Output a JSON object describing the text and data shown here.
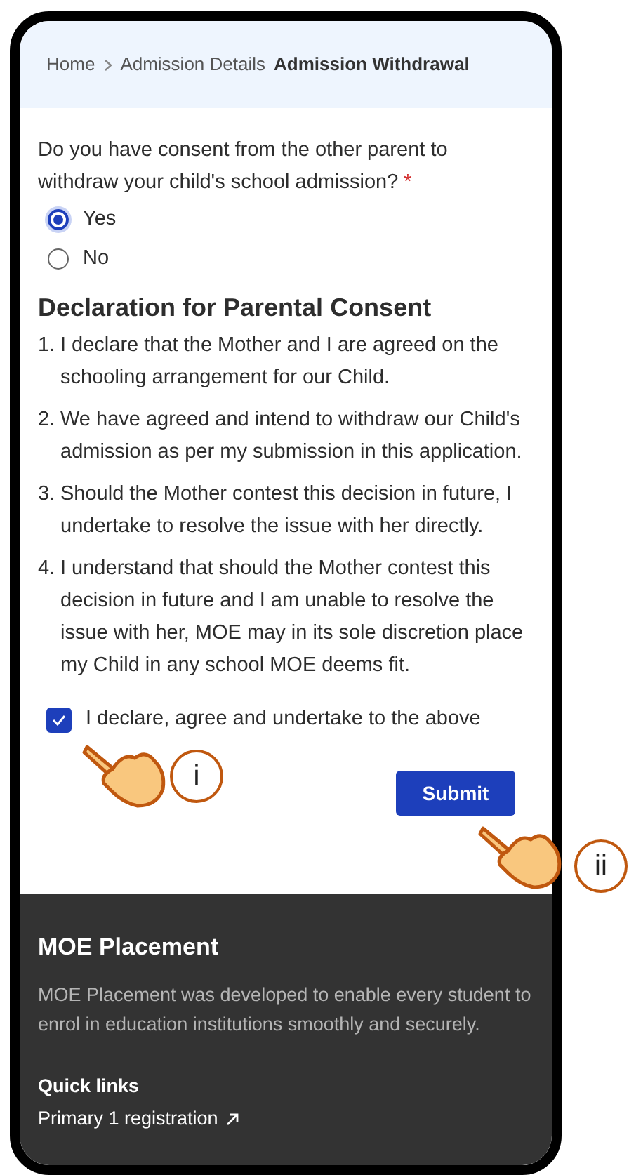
{
  "breadcrumb": [
    {
      "label": "Home",
      "chevron": true,
      "current": false
    },
    {
      "label": "Admission Details",
      "chevron": false,
      "current": false
    },
    {
      "label": "Admission Withdrawal",
      "chevron": false,
      "current": true
    }
  ],
  "question": {
    "text": "Do you have consent from the other parent to withdraw your child's school admission?",
    "required_mark": "*"
  },
  "options": [
    {
      "label": "Yes",
      "selected": true
    },
    {
      "label": "No",
      "selected": false
    }
  ],
  "declaration": {
    "title": "Declaration for Parental Consent",
    "items": [
      {
        "number": "1.",
        "text": "I declare that the Mother and I are agreed on the schooling arrangement for our Child."
      },
      {
        "number": "2.",
        "text": "We have agreed and intend to withdraw our Child's admission as per my submission in this application."
      },
      {
        "number": "3.",
        "text": "Should the Mother contest this decision in future, I undertake to resolve the issue with her directly."
      },
      {
        "number": "4.",
        "text": "I understand that should the Mother contest this decision in future and I am unable to resolve the issue with her, MOE may in its sole discretion place my Child in any school MOE deems fit."
      }
    ],
    "checkbox": {
      "label": "I declare, agree and undertake to the above",
      "checked": true
    }
  },
  "submit": "Submit",
  "footer": {
    "title": "MOE Placement",
    "description": "MOE Placement was developed to enable every student to enrol in education institutions smoothly and securely.",
    "quick_links_title": "Quick links",
    "links": [
      "Primary 1 registration"
    ]
  },
  "annotations": [
    {
      "label": "i"
    },
    {
      "label": "ii"
    }
  ]
}
